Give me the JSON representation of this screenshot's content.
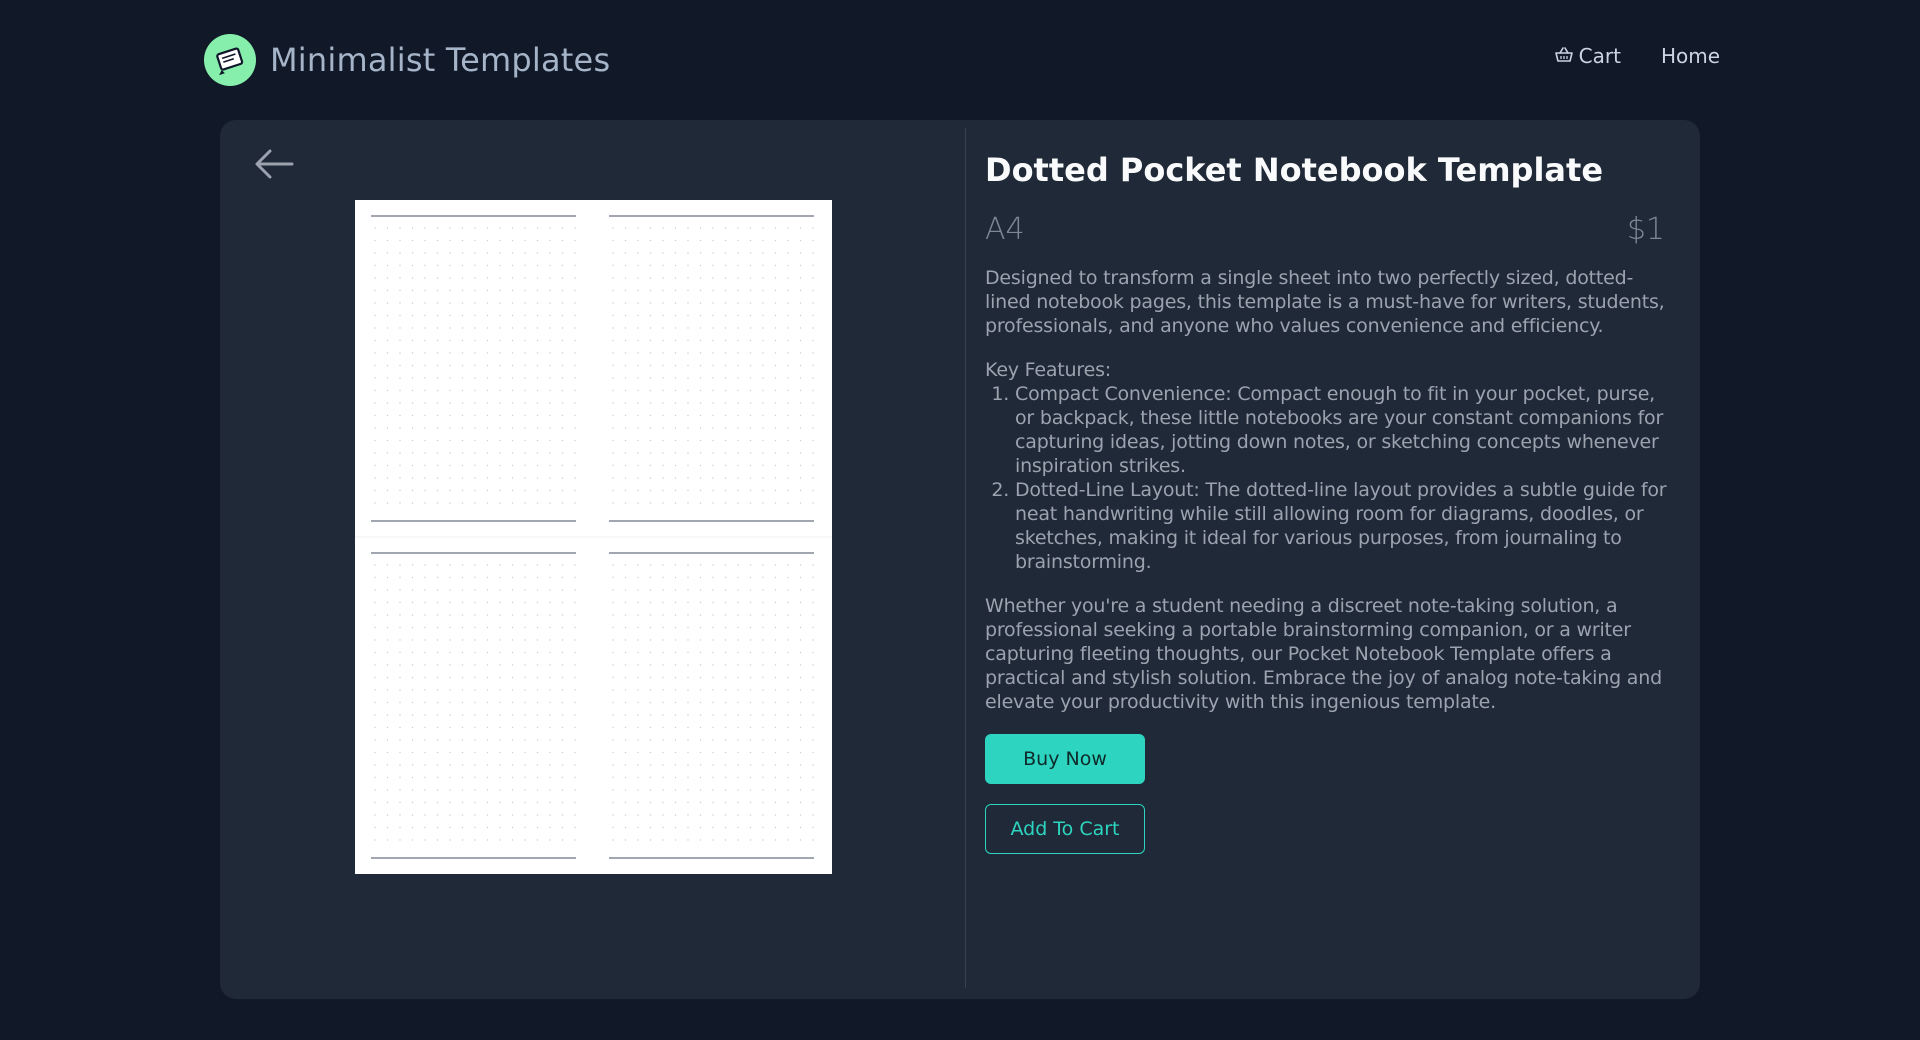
{
  "header": {
    "brand_name": "Minimalist Templates",
    "logo_icon": "notebook-logo-icon",
    "nav": [
      {
        "label": "Cart",
        "icon": "basket-icon"
      },
      {
        "label": "Home"
      }
    ]
  },
  "colors": {
    "page_bg": "#111827",
    "card_bg": "#1f2937",
    "accent": "#2dd4bf",
    "logo_bg": "#86efac"
  },
  "product": {
    "title": "Dotted Pocket Notebook Template",
    "size": "A4",
    "price": "$1",
    "description": "Designed to transform a single sheet into two perfectly sized, dotted-lined notebook pages, this template is a must-have for writers, students, professionals, and anyone who values convenience and efficiency.",
    "features_heading": "Key Features:",
    "features": [
      "Compact Convenience: Compact enough to fit in your pocket, purse, or backpack, these little notebooks are your constant companions for capturing ideas, jotting down notes, or sketching concepts whenever inspiration strikes.",
      "Dotted-Line Layout: The dotted-line layout provides a subtle guide for neat handwriting while still allowing room for diagrams, doodles, or sketches, making it ideal for various purposes, from journaling to brainstorming."
    ],
    "closing": "Whether you're a student needing a discreet note-taking solution, a professional seeking a portable brainstorming companion, or a writer capturing fleeting thoughts, our Pocket Notebook Template offers a practical and stylish solution. Embrace the joy of analog note-taking and elevate your productivity with this ingenious template.",
    "buy_label": "Buy Now",
    "cart_label": "Add  To Cart"
  }
}
